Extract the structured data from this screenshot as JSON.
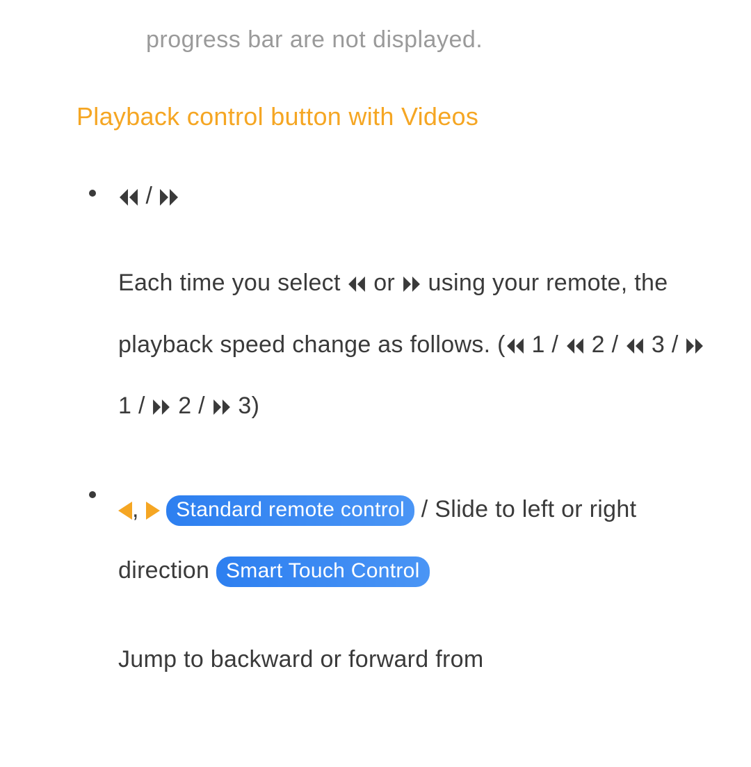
{
  "top_fragment": "progress bar are not displayed.",
  "heading": "Playback control button with Videos",
  "item1": {
    "header_slash": " / ",
    "body_part1": "Each time you select ",
    "body_part2": " or ",
    "body_part3": " using your remote, the playback speed change as follows. (",
    "body_s1": " 1 / ",
    "body_s2": " 2 / ",
    "body_s3": " 3 / ",
    "body_s4": " 1 / ",
    "body_s5": " 2 / ",
    "body_s6": " 3)"
  },
  "item2": {
    "comma": ", ",
    "pill1": "Standard remote control",
    "slash_slide": " / Slide to left or right direction ",
    "pill2": "Smart Touch Control",
    "body": "Jump to backward or forward from"
  }
}
